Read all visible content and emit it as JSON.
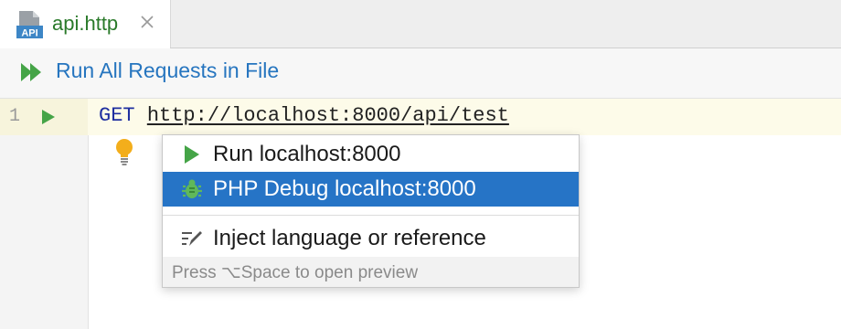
{
  "tab": {
    "icon_text": "API",
    "label": "api.http",
    "label_color": "#2a7a2a"
  },
  "toolbar": {
    "run_all_label": "Run All Requests in File",
    "accent": "#2675bf"
  },
  "editor": {
    "line_number": "1",
    "method": "GET",
    "url": "http://localhost:8000/api/test"
  },
  "popup": {
    "items": [
      {
        "label": "Run localhost:8000",
        "icon": "run-icon",
        "selected": false
      },
      {
        "label": "PHP Debug localhost:8000",
        "icon": "bug-icon",
        "selected": true
      },
      {
        "label": "Inject language or reference",
        "icon": "pencil-icon",
        "selected": false
      }
    ],
    "footer_hint": "Press ⌥Space to open preview",
    "selected_color": "#2674c6"
  }
}
